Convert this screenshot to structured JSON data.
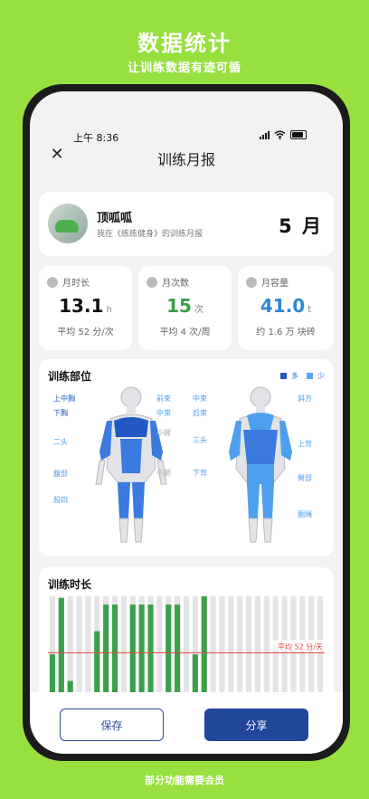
{
  "promo": {
    "title": "数据统计",
    "subtitle": "让训练数据有迹可循",
    "footer": "部分功能需要会员"
  },
  "status": {
    "time": "上午 8:36"
  },
  "nav": {
    "title": "训练月报"
  },
  "profile": {
    "name": "顶呱呱",
    "subtitle": "我在《练练健身》的训练月报",
    "month": "5 月"
  },
  "stats": [
    {
      "label": "月时长",
      "value": "13.1",
      "unit": "h",
      "foot": "平均 52 分/次",
      "color": "#111111"
    },
    {
      "label": "月次数",
      "value": "15",
      "unit": "次",
      "foot": "平均 4 次/周",
      "color": "#3aa04a"
    },
    {
      "label": "月容量",
      "value": "41.0",
      "unit": "t",
      "foot": "约 1.6 万 块砖",
      "color": "#2f86d6"
    }
  ],
  "muscles": {
    "title": "训练部位",
    "legend_more": "多",
    "legend_less": "少",
    "front_left": [
      "上中胸",
      "下胸",
      "二头",
      "腹部",
      "股四"
    ],
    "front_right": [
      "前束",
      "中束",
      "小臂",
      "小腿"
    ],
    "back_left": [
      "中束",
      "后束",
      "三头",
      "下背"
    ],
    "back_right": [
      "斜方",
      "上背",
      "臀部",
      "腘绳"
    ]
  },
  "chart_data": {
    "type": "bar",
    "title": "训练时长",
    "average_label": "平均 52 分/天",
    "average": 52,
    "ymax": 120,
    "values": [
      50,
      118,
      18,
      0,
      0,
      78,
      110,
      110,
      0,
      110,
      110,
      110,
      0,
      110,
      110,
      0,
      50,
      120,
      0,
      0,
      0,
      0,
      0,
      0,
      0,
      0,
      0,
      0,
      0,
      0,
      0
    ]
  },
  "actions": {
    "save": "保存",
    "share": "分享"
  }
}
